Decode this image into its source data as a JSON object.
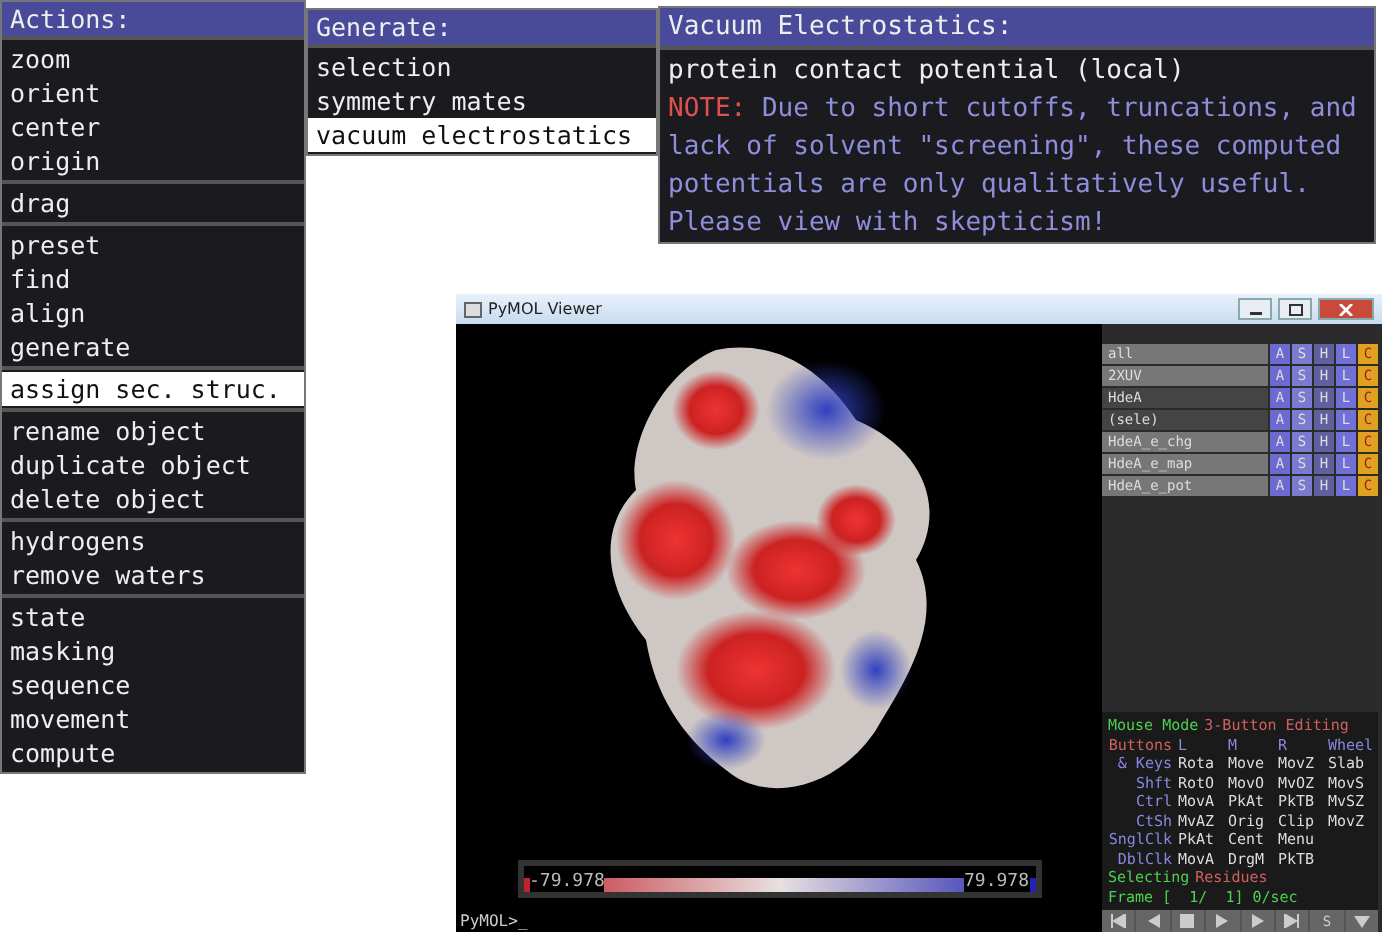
{
  "actions_menu": {
    "title": "Actions:",
    "groups": [
      [
        {
          "label": "zoom",
          "selected": false
        },
        {
          "label": "orient",
          "selected": false
        },
        {
          "label": "center",
          "selected": false
        },
        {
          "label": "origin",
          "selected": false
        }
      ],
      [
        {
          "label": "drag",
          "selected": false
        }
      ],
      [
        {
          "label": "preset",
          "selected": false
        },
        {
          "label": "find",
          "selected": false
        },
        {
          "label": "align",
          "selected": false
        },
        {
          "label": "generate",
          "selected": false
        }
      ],
      [
        {
          "label": "assign sec. struc.",
          "selected": true
        }
      ],
      [
        {
          "label": "rename object",
          "selected": false
        },
        {
          "label": "duplicate object",
          "selected": false
        },
        {
          "label": "delete object",
          "selected": false
        }
      ],
      [
        {
          "label": "hydrogens",
          "selected": false
        },
        {
          "label": "remove waters",
          "selected": false
        }
      ],
      [
        {
          "label": "state",
          "selected": false
        },
        {
          "label": "masking",
          "selected": false
        },
        {
          "label": "sequence",
          "selected": false
        },
        {
          "label": "movement",
          "selected": false
        },
        {
          "label": "compute",
          "selected": false
        }
      ]
    ]
  },
  "generate_menu": {
    "title": "Generate:",
    "items": [
      {
        "label": "selection",
        "selected": false
      },
      {
        "label": "symmetry mates",
        "selected": false
      },
      {
        "label": "vacuum electrostatics",
        "selected": true
      }
    ]
  },
  "electrostatics_menu": {
    "title": "Vacuum Electrostatics:",
    "items": [
      {
        "label": "protein contact potential (local)",
        "selected": false
      }
    ],
    "note": {
      "label": "NOTE:",
      "text": "Due to short cutoffs, truncations, and lack of solvent \"screening\", these computed potentials are only qualitatively useful. Please view with skepticism!"
    }
  },
  "viewer": {
    "title": "PyMOL Viewer",
    "colorbar": {
      "min": "-79.978",
      "max": "79.978"
    },
    "command_prompt": "PyMOL>_",
    "objects": [
      {
        "name": "all",
        "enabled": true,
        "buttons": [
          "A",
          "S",
          "H",
          "L",
          "C"
        ]
      },
      {
        "name": "2XUV",
        "enabled": true,
        "buttons": [
          "A",
          "S",
          "H",
          "L",
          "C"
        ]
      },
      {
        "name": "HdeA",
        "enabled": false,
        "buttons": [
          "A",
          "S",
          "H",
          "L",
          "C"
        ]
      },
      {
        "name": "(sele)",
        "enabled": false,
        "buttons": [
          "A",
          "S",
          "H",
          "L",
          "C"
        ]
      },
      {
        "name": "HdeA_e_chg",
        "enabled": true,
        "buttons": [
          "A",
          "S",
          "H",
          "L",
          "C"
        ]
      },
      {
        "name": "HdeA_e_map",
        "enabled": true,
        "buttons": [
          "A",
          "S",
          "H",
          "L",
          "C"
        ]
      },
      {
        "name": "HdeA_e_pot",
        "enabled": true,
        "buttons": [
          "A",
          "S",
          "H",
          "L",
          "C"
        ]
      }
    ],
    "mouse_panel": [
      {
        "kind": "title",
        "cells": [
          "Mouse Mode",
          "3-Button Editing"
        ]
      },
      {
        "kind": "header",
        "cells": [
          "Buttons",
          "L",
          "M",
          "R",
          "Wheel"
        ]
      },
      {
        "kind": "binding",
        "cells": [
          "& Keys",
          "Rota",
          "Move",
          "MovZ",
          "Slab"
        ]
      },
      {
        "kind": "binding",
        "cells": [
          "Shft",
          "RotO",
          "MovO",
          "MvOZ",
          "MovS"
        ]
      },
      {
        "kind": "binding",
        "cells": [
          "Ctrl",
          "MovA",
          "PkAt",
          "PkTB",
          "MvSZ"
        ]
      },
      {
        "kind": "binding",
        "cells": [
          "CtSh",
          "MvAZ",
          "Orig",
          "Clip",
          "MovZ"
        ]
      },
      {
        "kind": "binding",
        "cells": [
          "SnglClk",
          "PkAt",
          "Cent",
          "Menu"
        ]
      },
      {
        "kind": "binding",
        "cells": [
          "DblClk",
          "MovA",
          "DrgM",
          "PkTB"
        ]
      },
      {
        "kind": "title",
        "cells": [
          "Selecting",
          "Residues"
        ]
      },
      {
        "kind": "frame",
        "cells": [
          "Frame [  1/  1] 0/sec"
        ]
      }
    ],
    "playback": [
      {
        "kind": "first"
      },
      {
        "kind": "prev"
      },
      {
        "kind": "stop"
      },
      {
        "kind": "play"
      },
      {
        "kind": "next"
      },
      {
        "kind": "last"
      },
      {
        "kind": "text",
        "label": "S"
      },
      {
        "kind": "menu"
      }
    ]
  }
}
